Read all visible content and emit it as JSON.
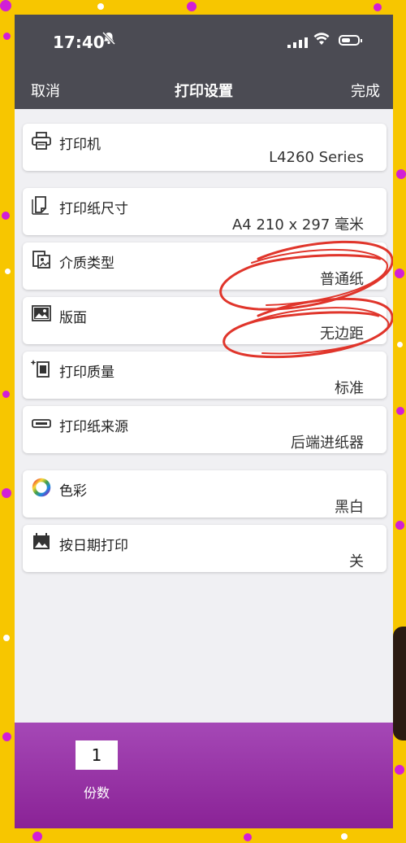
{
  "status_bar": {
    "time": "17:40"
  },
  "nav": {
    "cancel": "取消",
    "title": "打印设置",
    "done": "完成"
  },
  "settings": [
    {
      "label": "打印机",
      "value": "L4260 Series"
    },
    {
      "label": "打印纸尺寸",
      "value": "A4 210 x 297 毫米"
    },
    {
      "label": "介质类型",
      "value": "普通纸"
    },
    {
      "label": "版面",
      "value": "无边距"
    },
    {
      "label": "打印质量",
      "value": "标准"
    },
    {
      "label": "打印纸来源",
      "value": "后端进纸器"
    },
    {
      "label": "色彩",
      "value": "黑白"
    },
    {
      "label": "按日期打印",
      "value": "关"
    }
  ],
  "copies": {
    "value": "1",
    "label": "份数"
  },
  "colors": {
    "header": "#4b4b53",
    "bottom_bar": "#9a35a8",
    "annotation": "#e0352b",
    "background": "#f7c600"
  },
  "icons": [
    "bell-slash-icon",
    "signal-icon",
    "wifi-icon",
    "battery-icon",
    "printer-icon",
    "paper-size-icon",
    "media-type-icon",
    "layout-icon",
    "print-quality-icon",
    "paper-source-icon",
    "color-wheel-icon",
    "calendar-photo-icon"
  ]
}
